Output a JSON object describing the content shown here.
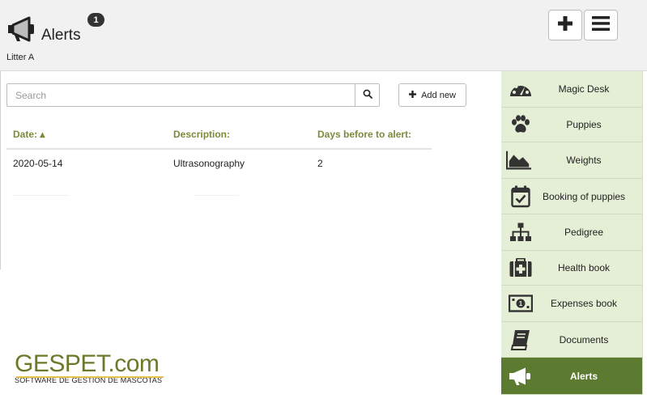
{
  "header": {
    "title": "Alerts",
    "badge_count": "1",
    "subtitle": "Litter A",
    "icons": {
      "title": "megaphone-icon",
      "add": "plus-icon",
      "menu": "hamburger-icon"
    }
  },
  "toolbar": {
    "search_placeholder": "Search",
    "search_value": "",
    "add_label": "Add new",
    "icons": {
      "search": "magnifier-icon",
      "add": "plus-icon"
    }
  },
  "table": {
    "columns": [
      "Date: ▴",
      "Description:",
      "Days before to alert:"
    ],
    "rows": [
      [
        "2020-05-14",
        "Ultrasonography",
        "2"
      ]
    ]
  },
  "logo": {
    "main": "GESPET.com",
    "sub": "SOFTWARE DE GESTIÓN DE MASCOTAS"
  },
  "sidebar": {
    "items": [
      {
        "label": "Magic Desk",
        "icon": "dashboard-gauge-icon"
      },
      {
        "label": "Puppies",
        "icon": "paw-icon"
      },
      {
        "label": "Weights",
        "icon": "area-chart-icon"
      },
      {
        "label": "Booking of puppies",
        "icon": "calendar-check-icon"
      },
      {
        "label": "Pedigree",
        "icon": "sitemap-icon"
      },
      {
        "label": "Health book",
        "icon": "medkit-icon"
      },
      {
        "label": "Expenses book",
        "icon": "money-bill-icon"
      },
      {
        "label": "Documents",
        "icon": "book-icon"
      },
      {
        "label": "Alerts",
        "icon": "megaphone-icon"
      }
    ],
    "active_index": 8
  },
  "colors": {
    "accent_green": "#5c7a30",
    "sidebar_bg": "#e4efd6",
    "header_text_green": "#7a8b3a",
    "logo_green": "#6b7a2a",
    "logo_gold": "#e6c34b"
  }
}
